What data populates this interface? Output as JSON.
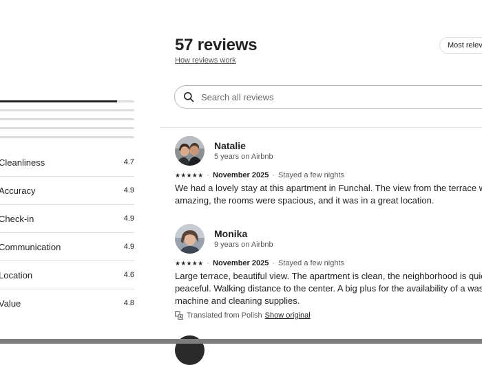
{
  "reviews_header": {
    "title": "57 reviews",
    "how_link": "How reviews work",
    "sort_label": "Most relevant"
  },
  "search": {
    "placeholder": "Search all reviews"
  },
  "rating_distribution": [
    0.87,
    0,
    0,
    0,
    0
  ],
  "categories": [
    {
      "label": "Cleanliness",
      "score": "4.7"
    },
    {
      "label": "Accuracy",
      "score": "4.9"
    },
    {
      "label": "Check-in",
      "score": "4.9"
    },
    {
      "label": "Communication",
      "score": "4.9"
    },
    {
      "label": "Location",
      "score": "4.6"
    },
    {
      "label": "Value",
      "score": "4.8"
    }
  ],
  "reviews": [
    {
      "name": "Natalie",
      "tenure": "5 years on Airbnb",
      "stars": "★★★★★",
      "date": "November 2025",
      "stay": "Stayed a few nights",
      "text": "We had a lovely stay at this apartment in Funchal. The view from the terrace was\namazing, the rooms were spacious, and it was in a great location."
    },
    {
      "name": "Monika",
      "tenure": "9 years on Airbnb",
      "stars": "★★★★★",
      "date": "November 2025",
      "stay": "Stayed a few nights",
      "text": "Large terrace, beautiful view. The apartment is clean, the neighborhood is quiet and\npeaceful. Walking distance to the center. A big plus for the availability of a washing\nmachine and cleaning supplies.",
      "translated_note": "Translated from Polish",
      "show_original": "Show original"
    }
  ],
  "colors": {
    "text": "#222222",
    "muted": "#555555",
    "divider": "#dddddd"
  }
}
